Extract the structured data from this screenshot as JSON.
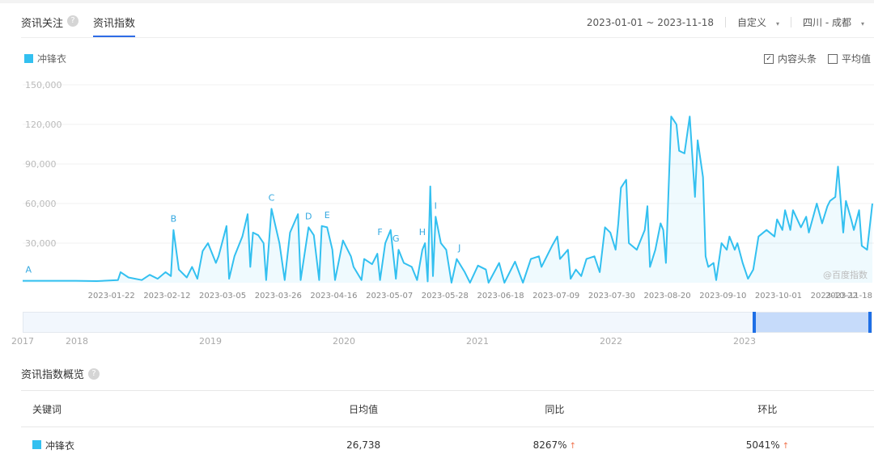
{
  "tabs": [
    {
      "label": "资讯关注",
      "help": "?"
    },
    {
      "label": "资讯指数"
    }
  ],
  "controls": {
    "date_range": "2023-01-01 ~ 2023-11-18",
    "period": "自定义",
    "region": "四川 - 成都",
    "caret": "▾"
  },
  "options": [
    {
      "label": "内容头条",
      "checked": true,
      "mark": "✓"
    },
    {
      "label": "平均值",
      "checked": false,
      "mark": ""
    }
  ],
  "watermark": "@百度指数",
  "colors": {
    "series": "#33c0f0",
    "accent": "#2e6be6",
    "up": "#f0704a"
  },
  "chart_data": {
    "type": "area",
    "title": "",
    "legend": [
      "冲锋衣"
    ],
    "legend_position": "top-left",
    "x_start": "2023-01-01",
    "x_end": "2023-11-18",
    "xlabel": "",
    "ylabel": "",
    "ylim": [
      0,
      150000
    ],
    "yticks": [
      "150,000",
      "120,000",
      "90,000",
      "60,000",
      "30,000"
    ],
    "ytick_values": [
      150000,
      120000,
      90000,
      60000,
      30000
    ],
    "xticks": [
      "2023-01-22",
      "2023-02-12",
      "2023-03-05",
      "2023-03-26",
      "2023-04-16",
      "2023-05-07",
      "2023-05-28",
      "2023-06-18",
      "2023-07-09",
      "2023-07-30",
      "2023-08-20",
      "2023-09-10",
      "2023-10-01",
      "2023-10-22",
      "2023-11-18"
    ],
    "xtick_days": [
      21,
      42,
      63,
      84,
      105,
      126,
      147,
      168,
      189,
      210,
      231,
      252,
      273,
      294,
      321
    ],
    "series": [
      {
        "name": "冲锋衣",
        "points": [
          [
            0,
            1500
          ],
          [
            20,
            1500
          ],
          [
            28,
            1200
          ],
          [
            36,
            2000
          ],
          [
            37,
            8000
          ],
          [
            40,
            4000
          ],
          [
            45,
            2000
          ],
          [
            48,
            6000
          ],
          [
            51,
            3000
          ],
          [
            54,
            8000
          ],
          [
            56,
            5000
          ],
          [
            57,
            40000
          ],
          [
            59,
            10000
          ],
          [
            62,
            4000
          ],
          [
            64,
            12000
          ],
          [
            66,
            3000
          ],
          [
            68,
            24000
          ],
          [
            70,
            30000
          ],
          [
            73,
            15000
          ],
          [
            74,
            20000
          ],
          [
            77,
            43000
          ],
          [
            78,
            3000
          ],
          [
            80,
            20000
          ],
          [
            83,
            35000
          ],
          [
            85,
            52000
          ],
          [
            86,
            12000
          ],
          [
            87,
            38000
          ],
          [
            89,
            36000
          ],
          [
            91,
            30000
          ],
          [
            92,
            2000
          ],
          [
            94,
            56000
          ],
          [
            97,
            30000
          ],
          [
            99,
            2000
          ],
          [
            101,
            38000
          ],
          [
            104,
            52000
          ],
          [
            105,
            2000
          ],
          [
            108,
            42000
          ],
          [
            110,
            36000
          ],
          [
            112,
            2000
          ],
          [
            113,
            43000
          ],
          [
            115,
            42000
          ],
          [
            117,
            25000
          ],
          [
            118,
            2000
          ],
          [
            121,
            32000
          ],
          [
            124,
            20000
          ],
          [
            125,
            12000
          ],
          [
            128,
            2000
          ],
          [
            129,
            18000
          ],
          [
            132,
            14000
          ],
          [
            134,
            22000
          ],
          [
            135,
            2000
          ],
          [
            137,
            30000
          ],
          [
            139,
            40000
          ],
          [
            141,
            3000
          ],
          [
            142,
            25000
          ],
          [
            144,
            15000
          ],
          [
            147,
            12000
          ],
          [
            149,
            2000
          ],
          [
            151,
            25000
          ],
          [
            152,
            30000
          ],
          [
            153,
            1000
          ],
          [
            154,
            73000
          ],
          [
            155,
            5000
          ],
          [
            156,
            50000
          ],
          [
            158,
            30000
          ],
          [
            160,
            25000
          ],
          [
            162,
            0
          ],
          [
            164,
            18000
          ],
          [
            167,
            8000
          ],
          [
            169,
            0
          ],
          [
            172,
            13000
          ],
          [
            175,
            10000
          ],
          [
            176,
            0
          ],
          [
            180,
            15000
          ],
          [
            182,
            0
          ],
          [
            186,
            16000
          ],
          [
            189,
            0
          ],
          [
            192,
            18000
          ],
          [
            195,
            20000
          ],
          [
            196,
            12000
          ],
          [
            200,
            28000
          ],
          [
            202,
            35000
          ],
          [
            203,
            18000
          ],
          [
            206,
            25000
          ],
          [
            207,
            3000
          ],
          [
            209,
            10000
          ],
          [
            211,
            5000
          ],
          [
            213,
            18000
          ],
          [
            216,
            20000
          ],
          [
            218,
            8000
          ],
          [
            220,
            42000
          ],
          [
            222,
            38000
          ],
          [
            224,
            25000
          ],
          [
            225,
            45000
          ],
          [
            226,
            72000
          ],
          [
            228,
            78000
          ],
          [
            229,
            30000
          ],
          [
            232,
            25000
          ],
          [
            235,
            40000
          ],
          [
            236,
            58000
          ],
          [
            237,
            12000
          ],
          [
            239,
            25000
          ],
          [
            241,
            45000
          ],
          [
            242,
            40000
          ],
          [
            243,
            15000
          ],
          [
            245,
            126000
          ],
          [
            247,
            120000
          ],
          [
            248,
            100000
          ],
          [
            250,
            98000
          ],
          [
            252,
            126000
          ],
          [
            254,
            65000
          ],
          [
            255,
            108000
          ],
          [
            257,
            80000
          ],
          [
            258,
            20000
          ],
          [
            259,
            12000
          ],
          [
            261,
            15000
          ],
          [
            262,
            2000
          ],
          [
            264,
            30000
          ],
          [
            266,
            25000
          ],
          [
            267,
            35000
          ],
          [
            269,
            25000
          ],
          [
            270,
            30000
          ],
          [
            272,
            15000
          ],
          [
            274,
            3000
          ],
          [
            276,
            10000
          ],
          [
            278,
            35000
          ],
          [
            281,
            40000
          ],
          [
            284,
            35000
          ],
          [
            285,
            48000
          ],
          [
            287,
            40000
          ],
          [
            288,
            55000
          ],
          [
            290,
            40000
          ],
          [
            291,
            55000
          ],
          [
            294,
            42000
          ],
          [
            296,
            50000
          ],
          [
            297,
            38000
          ],
          [
            300,
            60000
          ],
          [
            302,
            45000
          ],
          [
            304,
            58000
          ],
          [
            305,
            62000
          ],
          [
            307,
            65000
          ],
          [
            308,
            88000
          ],
          [
            310,
            38000
          ],
          [
            311,
            62000
          ],
          [
            313,
            48000
          ],
          [
            314,
            40000
          ],
          [
            316,
            55000
          ],
          [
            317,
            28000
          ],
          [
            319,
            25000
          ],
          [
            321,
            60000
          ]
        ]
      }
    ],
    "annotations": [
      {
        "label": "A",
        "day": 1,
        "value": 1500
      },
      {
        "label": "B",
        "day": 57,
        "value": 40000
      },
      {
        "label": "C",
        "day": 94,
        "value": 56000
      },
      {
        "label": "D",
        "day": 108,
        "value": 42000
      },
      {
        "label": "E",
        "day": 115,
        "value": 43000
      },
      {
        "label": "F",
        "day": 135,
        "value": 30000
      },
      {
        "label": "G",
        "day": 141,
        "value": 25000
      },
      {
        "label": "H",
        "day": 151,
        "value": 30000
      },
      {
        "label": "I",
        "day": 156,
        "value": 50000
      },
      {
        "label": "J",
        "day": 165,
        "value": 18000
      }
    ]
  },
  "navigator": {
    "years": [
      "2017",
      "2018",
      "2019",
      "2020",
      "2021",
      "2022",
      "2023"
    ]
  },
  "overview": {
    "title": "资讯指数概览",
    "help": "?",
    "columns": [
      "关键词",
      "日均值",
      "同比",
      "环比"
    ],
    "rows": [
      {
        "keyword": "冲锋衣",
        "avg": "26,738",
        "yoy": "8267%",
        "mom": "5041%",
        "arrow": "↑"
      }
    ]
  }
}
